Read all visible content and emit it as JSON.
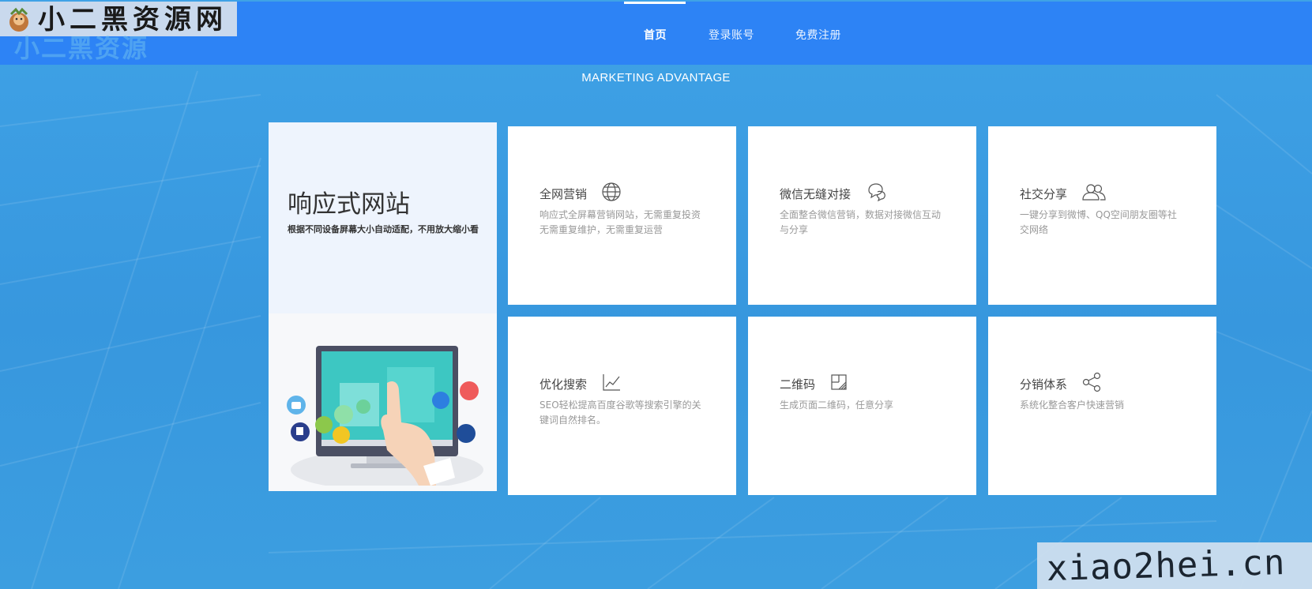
{
  "logo": {
    "text": "小二黑资源网",
    "ghost_text": "小二黑资源"
  },
  "nav": {
    "items": [
      {
        "label": "首页",
        "active": true
      },
      {
        "label": "登录账号",
        "active": false
      },
      {
        "label": "免费注册",
        "active": false
      }
    ]
  },
  "section": {
    "title": "MARKETING ADVANTAGE"
  },
  "hero": {
    "title": "响应式网站",
    "subtitle": "根据不同设备屏幕大小自动适配，不用放大缩小看"
  },
  "cards": [
    {
      "title": "全网营销",
      "icon": "globe-icon",
      "desc": "响应式全屏幕营销网站，无需重复投资无需重复维护，无需重复运营"
    },
    {
      "title": "微信无缝对接",
      "icon": "chat-bubbles-icon",
      "desc": "全面整合微信营销，数据对接微信互动与分享"
    },
    {
      "title": "社交分享",
      "icon": "users-icon",
      "desc": "一键分享到微博、QQ空间朋友圈等社交网络"
    },
    {
      "title": "优化搜索",
      "icon": "trend-chart-icon",
      "desc": "SEO轻松提高百度谷歌等搜索引擎的关键词自然排名。"
    },
    {
      "title": "二维码",
      "icon": "qrcode-icon",
      "desc": "生成页面二维码，任意分享"
    },
    {
      "title": "分销体系",
      "icon": "share-nodes-icon",
      "desc": "系统化整合客户快速营销"
    }
  ],
  "watermark": {
    "text": "xiao2hei.cn"
  },
  "colors": {
    "header": "#2d83f5",
    "background": "#3a9ae0",
    "card": "#ffffff",
    "hero_top": "#eef4fd"
  }
}
